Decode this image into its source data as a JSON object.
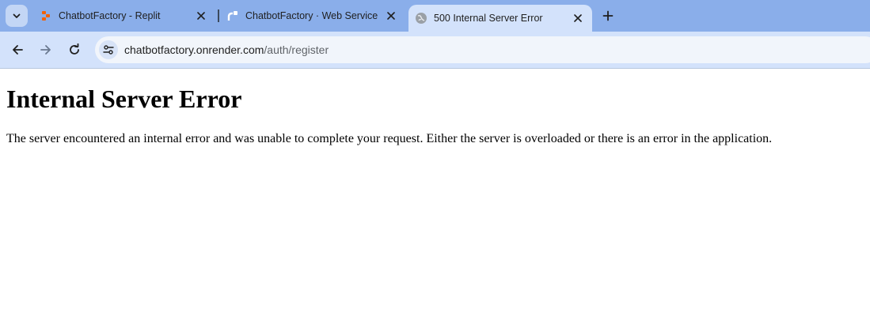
{
  "browser": {
    "tabs": [
      {
        "title": "ChatbotFactory - Replit",
        "favicon": "replit-icon",
        "active": false
      },
      {
        "title": "ChatbotFactory · Web Service",
        "favicon": "render-icon",
        "active": false
      },
      {
        "title": "500 Internal Server Error",
        "favicon": "globe-icon",
        "active": true
      }
    ],
    "address": {
      "host": "chatbotfactory.onrender.com",
      "path": "/auth/register"
    },
    "colors": {
      "tabstrip": "#8aaeea",
      "active_tab": "#d3e2fb",
      "replit_orange": "#f26207"
    }
  },
  "page": {
    "heading": "Internal Server Error",
    "message": "The server encountered an internal error and was unable to complete your request. Either the server is overloaded or there is an error in the application."
  }
}
